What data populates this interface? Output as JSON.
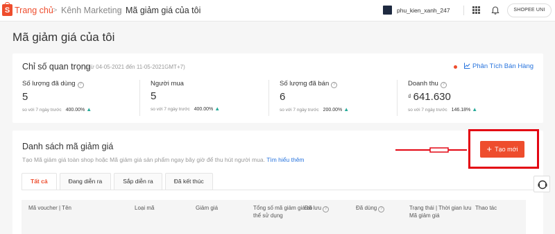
{
  "header": {
    "logo_letter": "S",
    "breadcrumb": [
      "Trang chủ",
      "Kênh Marketing",
      "Mã giảm giá của tôi"
    ],
    "separator": ">",
    "username": "phu_kien_xanh_247",
    "shop_button": "SHOPEE UNI"
  },
  "page": {
    "title": "Mã giảm giá của tôi"
  },
  "key_metrics": {
    "title": "Chỉ số quan trọng",
    "date_range": "(Từ 04-05-2021 đến 11-05-2021GMT+7)",
    "analysis_link": "Phân Tích Bán Hàng",
    "compare_label": "so với 7 ngày trước",
    "items": [
      {
        "label": "Số lượng đã dùng",
        "value": "5",
        "change": "400.00%"
      },
      {
        "label": "Người mua",
        "value": "5",
        "change": "400.00%"
      },
      {
        "label": "Số lượng đã bán",
        "value": "6",
        "change": "200.00%"
      },
      {
        "label": "Doanh thu",
        "currency": "₫",
        "value": "641.630",
        "change": "146.18%"
      }
    ]
  },
  "voucher_list": {
    "title": "Danh sách mã giảm giá",
    "description": "Tạo Mã giảm giá toàn shop hoặc Mã giảm giá sản phẩm ngay bây giờ để thu hút người mua.",
    "learn_more": "Tìm hiểu thêm",
    "create_button": "Tạo mới",
    "tabs": [
      "Tất cả",
      "Đang diễn ra",
      "Sắp diễn ra",
      "Đã kết thúc"
    ],
    "columns": [
      "Mã voucher | Tên",
      "Loại mã",
      "Giảm giá",
      "Tổng số mã giảm giá có thể sử dụng",
      "Đã lưu",
      "Đã dùng",
      "Trạng thái | Thời gian lưu Mã giảm giá",
      "Thao tác"
    ]
  },
  "colors": {
    "brand": "#ee4d2d",
    "link": "#2673dd",
    "positive": "#26aa99",
    "annotation": "#e30613"
  }
}
